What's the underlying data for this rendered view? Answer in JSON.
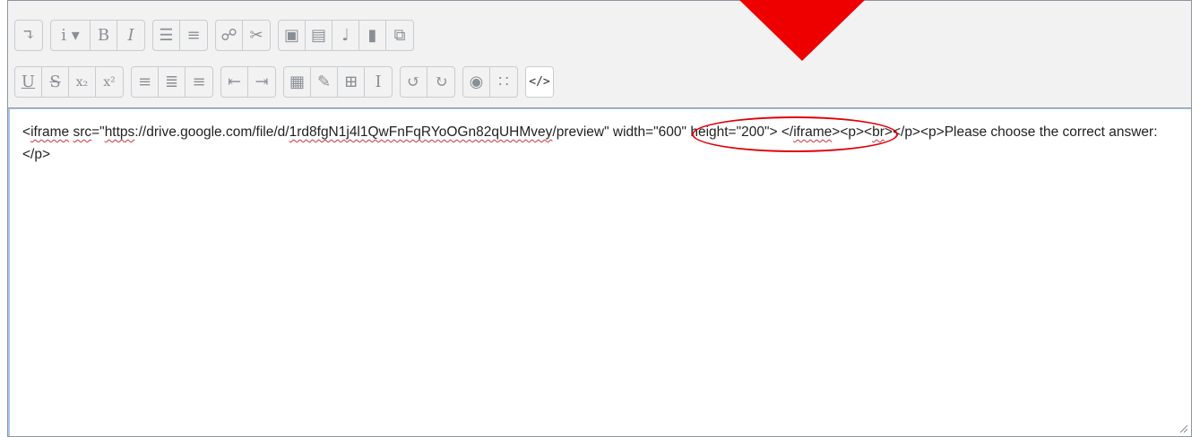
{
  "toolbar": {
    "row1": [
      [
        {
          "name": "toolbar-toggle-icon",
          "glyph": "↴"
        }
      ],
      [
        {
          "name": "paragraph-style-dropdown",
          "glyph": "i ▾",
          "wide": true
        },
        {
          "name": "bold-icon",
          "glyph": "B"
        },
        {
          "name": "italic-icon",
          "glyph": "I"
        }
      ],
      [
        {
          "name": "unordered-list-icon",
          "glyph": "☰"
        },
        {
          "name": "ordered-list-icon",
          "glyph": "≡"
        }
      ],
      [
        {
          "name": "link-icon",
          "glyph": "☍"
        },
        {
          "name": "unlink-icon",
          "glyph": "✂"
        }
      ],
      [
        {
          "name": "image-icon",
          "glyph": "▣"
        },
        {
          "name": "media-icon",
          "glyph": "▤"
        },
        {
          "name": "microphone-icon",
          "glyph": "♩"
        },
        {
          "name": "video-icon",
          "glyph": "▮"
        },
        {
          "name": "manage-files-icon",
          "glyph": "⧉"
        }
      ]
    ],
    "row2": [
      [
        {
          "name": "underline-icon",
          "glyph": "U"
        },
        {
          "name": "strikethrough-icon",
          "glyph": "S"
        },
        {
          "name": "subscript-icon",
          "glyph": "x₂"
        },
        {
          "name": "superscript-icon",
          "glyph": "x²"
        }
      ],
      [
        {
          "name": "align-left-icon",
          "glyph": "≡"
        },
        {
          "name": "align-center-icon",
          "glyph": "≣"
        },
        {
          "name": "align-right-icon",
          "glyph": "≡"
        }
      ],
      [
        {
          "name": "outdent-icon",
          "glyph": "⇤"
        },
        {
          "name": "indent-icon",
          "glyph": "⇥"
        }
      ],
      [
        {
          "name": "equation-icon",
          "glyph": "▦"
        },
        {
          "name": "special-character-icon",
          "glyph": "✎"
        },
        {
          "name": "table-icon",
          "glyph": "⊞"
        },
        {
          "name": "clear-formatting-icon",
          "glyph": "I"
        }
      ],
      [
        {
          "name": "undo-icon",
          "glyph": "↺"
        },
        {
          "name": "redo-icon",
          "glyph": "↻"
        }
      ],
      [
        {
          "name": "accessibility-checker-icon",
          "glyph": "◉"
        },
        {
          "name": "screenreader-helper-icon",
          "glyph": "∷"
        }
      ],
      [
        {
          "name": "html-toggle-icon",
          "glyph": "</>",
          "active": true
        }
      ]
    ]
  },
  "editor": {
    "segments": [
      {
        "text": "<"
      },
      {
        "text": "iframe",
        "spell": true
      },
      {
        "text": " "
      },
      {
        "text": "src",
        "spell": true
      },
      {
        "text": "=\""
      },
      {
        "text": "https",
        "spell": true
      },
      {
        "text": "://drive.google.com/file/d/"
      },
      {
        "text": "1rd8fgN1j4l1QwFnFqRYoOGn82qUHMvey",
        "spell": true
      },
      {
        "text": "/preview\" width=\"600\" height=\"200\"> </"
      },
      {
        "text": "iframe",
        "spell": true
      },
      {
        "text": "><p><"
      },
      {
        "text": "br",
        "spell": true
      },
      {
        "text": "></p><p>Please choose the correct answer:</p>"
      }
    ]
  },
  "colors": {
    "annotation_red": "#e0000b",
    "toolbar_bg": "#f2f2f2",
    "spellcheck_red": "#d0333d"
  }
}
